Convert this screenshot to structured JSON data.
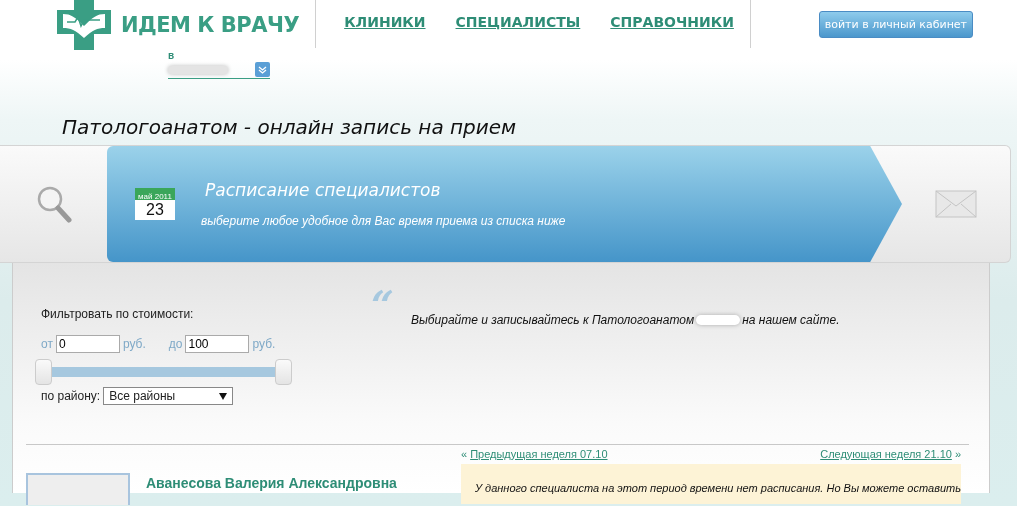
{
  "header": {
    "logo_text": "ИДЕМ К ВРАЧУ",
    "nav": [
      {
        "label": "КЛИНИКИ"
      },
      {
        "label": "СПЕЦИАЛИСТЫ"
      },
      {
        "label": "СПРАВОЧНИКИ"
      }
    ],
    "login_button": "войти в личный кабинет",
    "city_label": "в"
  },
  "page_title": "Патологоанатом - онлайн запись на прием",
  "banner": {
    "calendar_month": "май 2011",
    "calendar_day": "23",
    "title": "Расписание специалистов",
    "subtitle": "выберите любое удобное для Вас время приема из списка ниже"
  },
  "filter": {
    "label": "Фильтровать по стоимости:",
    "from_label": "от",
    "from_value": "0",
    "to_label": "до",
    "to_value": "100",
    "currency_from": "руб.",
    "currency_to": "руб.",
    "price_slider": {
      "level": 1
    },
    "district_label": "по району:",
    "district_value": "Все районы"
  },
  "intro": {
    "quote_mark": "“",
    "text_before": "Выбирайте и записывайтесь к Патологоанатом",
    "text_after": "на нашем сайте."
  },
  "week_nav": {
    "prev_arrow": "«",
    "prev": "Предыдущая неделя 07.10",
    "next": "Следующая неделя 21.10",
    "next_arrow": "»"
  },
  "doctor": {
    "name": "Аванесова Валерия Александровна",
    "notice": "У данного специалиста на этот период времени нет расписания. Но Вы можете оставить"
  }
}
